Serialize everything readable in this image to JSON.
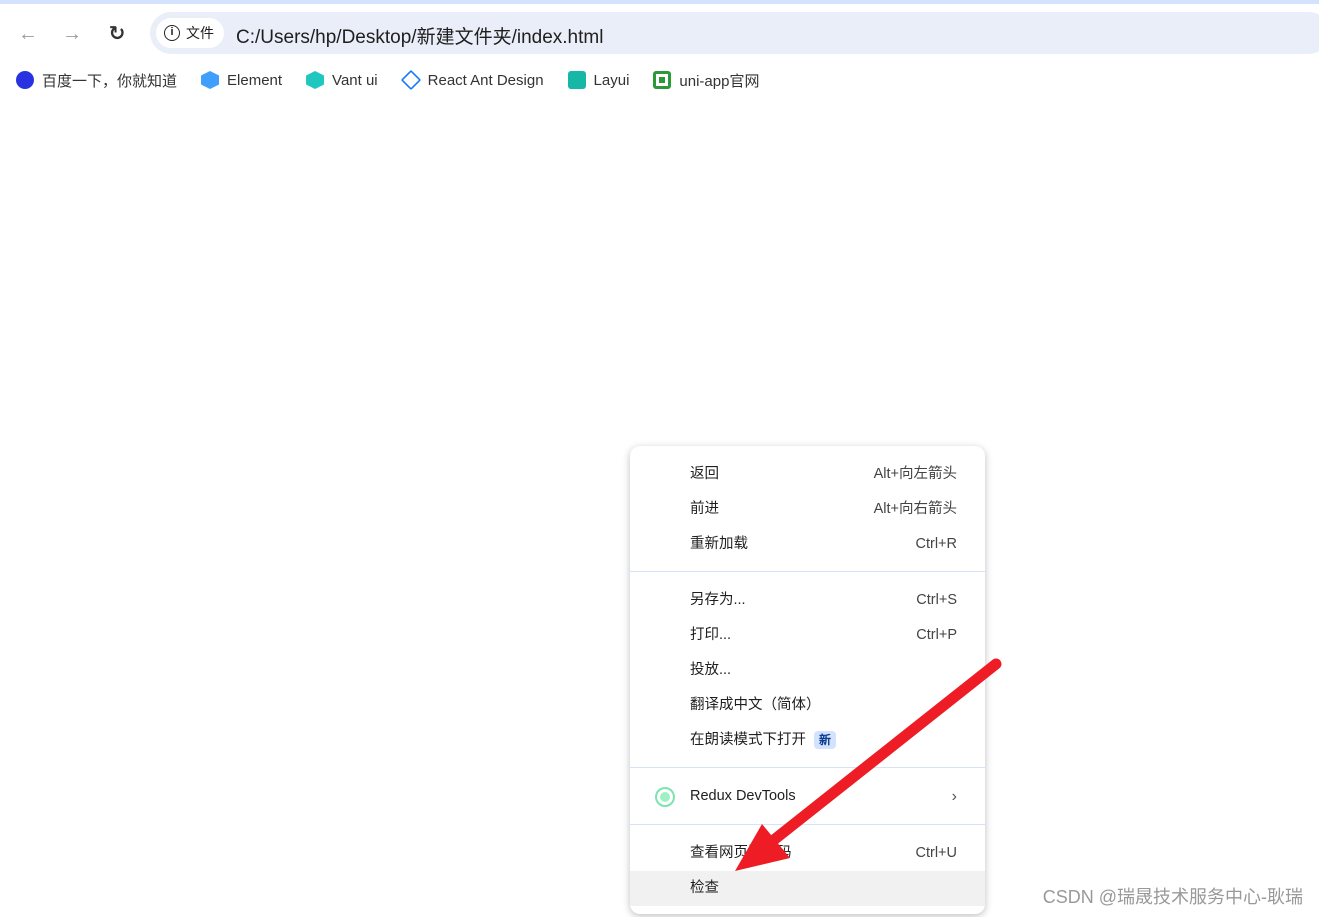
{
  "toolbar": {
    "back_icon": "arrow-left",
    "forward_icon": "arrow-right",
    "reload_icon": "reload",
    "chip_label": "文件",
    "url": "C:/Users/hp/Desktop/新建文件夹/index.html"
  },
  "bookmarks": [
    {
      "label": "百度一下，你就知道",
      "color": "#2932e1"
    },
    {
      "label": "Element",
      "color": "#409eff"
    },
    {
      "label": "Vant ui",
      "color": "#1fc7c0"
    },
    {
      "label": "React Ant Design",
      "color": "#1677ff"
    },
    {
      "label": "Layui",
      "color": "#16b7a6"
    },
    {
      "label": "uni-app官网",
      "color": "#2b9939"
    }
  ],
  "menu": {
    "items": [
      {
        "label": "返回",
        "shortcut": "Alt+向左箭头"
      },
      {
        "label": "前进",
        "shortcut": "Alt+向右箭头"
      },
      {
        "label": "重新加载",
        "shortcut": "Ctrl+R"
      },
      {
        "label": "另存为...",
        "shortcut": "Ctrl+S"
      },
      {
        "label": "打印...",
        "shortcut": "Ctrl+P"
      },
      {
        "label": "投放...",
        "shortcut": ""
      },
      {
        "label": "翻译成中文（简体）",
        "shortcut": ""
      },
      {
        "label": "在朗读模式下打开",
        "shortcut": "",
        "badge": "新"
      },
      {
        "label": "Redux DevTools",
        "shortcut": ""
      },
      {
        "label": "查看网页源代码",
        "shortcut": "Ctrl+U"
      },
      {
        "label": "检查",
        "shortcut": ""
      }
    ]
  },
  "annotation": {
    "arrow_color": "#ee1c25"
  },
  "watermark": "CSDN @瑞晟技术服务中心-耿瑞"
}
